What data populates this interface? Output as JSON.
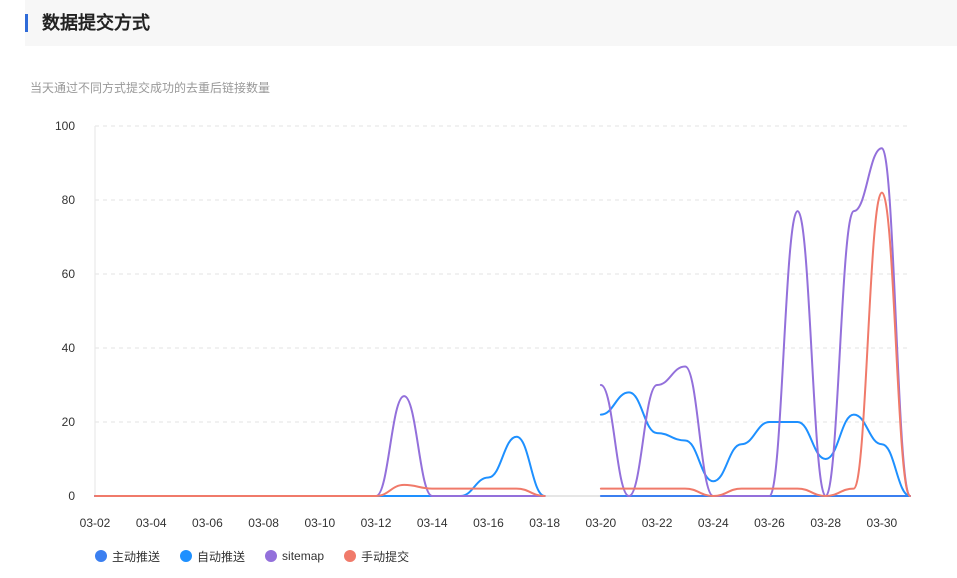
{
  "header": {
    "title": "数据提交方式"
  },
  "subtitle": "当天通过不同方式提交成功的去重后链接数量",
  "chart_data": {
    "type": "line",
    "title": "",
    "xlabel": "",
    "ylabel": "",
    "ylim": [
      0,
      100
    ],
    "yticks": [
      0,
      20,
      40,
      60,
      80,
      100
    ],
    "grid": true,
    "legend_position": "bottom-left",
    "x_tick_labels": [
      "03-02",
      "03-04",
      "03-06",
      "03-08",
      "03-10",
      "03-12",
      "03-14",
      "03-16",
      "03-18",
      "03-20",
      "03-22",
      "03-24",
      "03-26",
      "03-28",
      "03-30"
    ],
    "categories": [
      "03-02",
      "03-03",
      "03-04",
      "03-05",
      "03-06",
      "03-07",
      "03-08",
      "03-09",
      "03-10",
      "03-11",
      "03-12",
      "03-13",
      "03-14",
      "03-15",
      "03-16",
      "03-17",
      "03-18",
      "03-19",
      "03-20",
      "03-21",
      "03-22",
      "03-23",
      "03-24",
      "03-25",
      "03-26",
      "03-27",
      "03-28",
      "03-29",
      "03-30",
      "03-31"
    ],
    "series": [
      {
        "name": "主动推送",
        "color": "#3b7ff0",
        "values": [
          0,
          0,
          0,
          0,
          0,
          0,
          0,
          0,
          0,
          0,
          0,
          0,
          0,
          0,
          0,
          0,
          0,
          null,
          0,
          0,
          0,
          0,
          0,
          0,
          0,
          0,
          0,
          0,
          0,
          0
        ]
      },
      {
        "name": "自动推送",
        "color": "#1e90ff",
        "values": [
          0,
          0,
          0,
          0,
          0,
          0,
          0,
          0,
          0,
          0,
          0,
          0,
          0,
          0,
          5,
          16,
          0,
          null,
          22,
          28,
          17,
          15,
          4,
          14,
          20,
          20,
          10,
          22,
          14,
          0
        ]
      },
      {
        "name": "sitemap",
        "color": "#9370db",
        "values": [
          0,
          0,
          0,
          0,
          0,
          0,
          0,
          0,
          0,
          0,
          0,
          27,
          0,
          0,
          0,
          0,
          0,
          null,
          30,
          0,
          30,
          35,
          0,
          0,
          0,
          77,
          0,
          77,
          94,
          0
        ]
      },
      {
        "name": "手动提交",
        "color": "#f07a6a",
        "values": [
          0,
          0,
          0,
          0,
          0,
          0,
          0,
          0,
          0,
          0,
          0,
          3,
          2,
          2,
          2,
          2,
          0,
          null,
          2,
          2,
          2,
          2,
          0,
          2,
          2,
          2,
          0,
          2,
          82,
          0
        ]
      }
    ]
  }
}
